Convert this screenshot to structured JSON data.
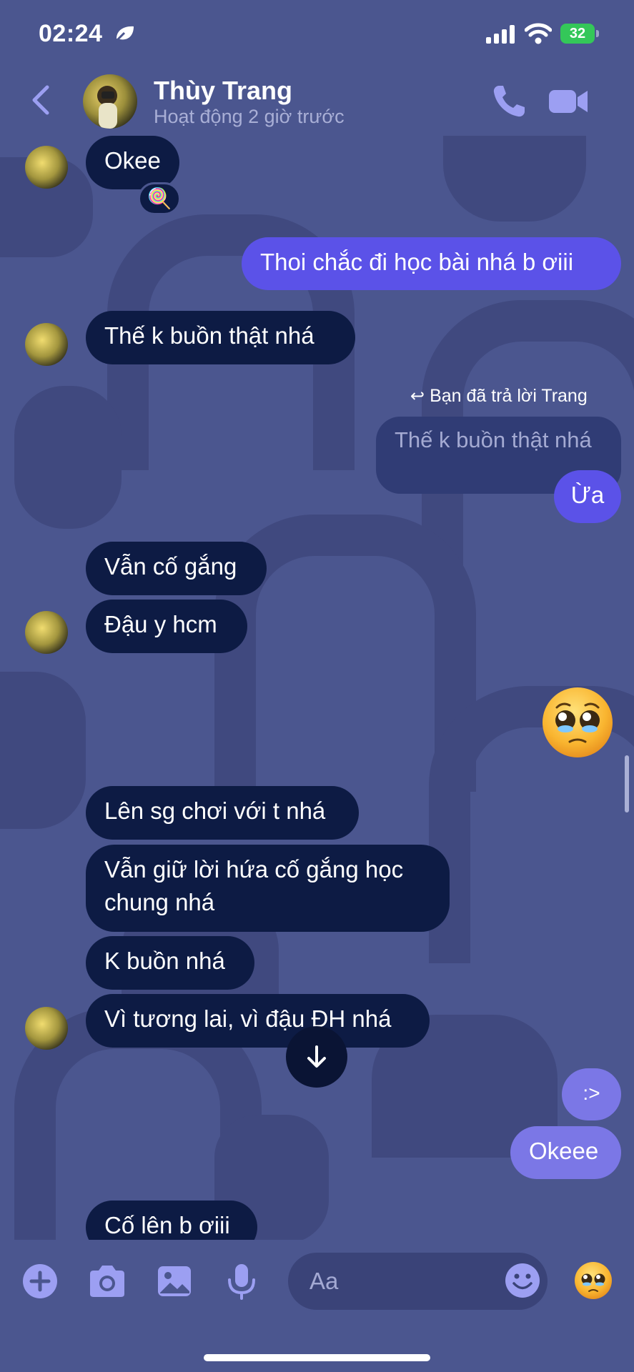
{
  "status_bar": {
    "time": "02:24",
    "battery": "32"
  },
  "header": {
    "name": "Thùy Trang",
    "status": "Hoạt động 2 giờ trước"
  },
  "messages": [
    {
      "from": "them",
      "text": "Okee",
      "reaction": "🍭"
    },
    {
      "from": "me",
      "text": "Thoi chắc đi học bài nhá b ơiii"
    },
    {
      "from": "them",
      "text": "Thế k buồn thật nhá"
    },
    {
      "from": "me",
      "reply_label": "Bạn đã trả lời Trang",
      "quoted": "Thế k buồn thật nhá",
      "text": "Ừa"
    },
    {
      "from": "them",
      "text": "Vẫn cố gắng"
    },
    {
      "from": "them",
      "text": "Đậu y hcm"
    },
    {
      "from": "me",
      "text": "🥹"
    },
    {
      "from": "them",
      "text": "Lên sg chơi với t nhá"
    },
    {
      "from": "them",
      "text": "Vẫn giữ lời hứa cố gắng học chung nhá",
      "line1": "Vẫn giữ lời hứa cố gắng học",
      "line2": "chung nhá"
    },
    {
      "from": "them",
      "text": "K buồn nhá"
    },
    {
      "from": "them",
      "text": "Vì tương lai, vì đậu ĐH nhá"
    },
    {
      "from": "me",
      "text": ":>"
    },
    {
      "from": "me",
      "text": "Okeee"
    },
    {
      "from": "them",
      "text": "Cố lên b ơiii"
    }
  ],
  "composer": {
    "placeholder": "Aa",
    "quick_reaction": "🥹"
  },
  "icons": [
    "back-icon",
    "phone-icon",
    "video-camera-icon",
    "plus-icon",
    "camera-icon",
    "image-icon",
    "microphone-icon",
    "smile-icon",
    "arrow-down-icon"
  ]
}
